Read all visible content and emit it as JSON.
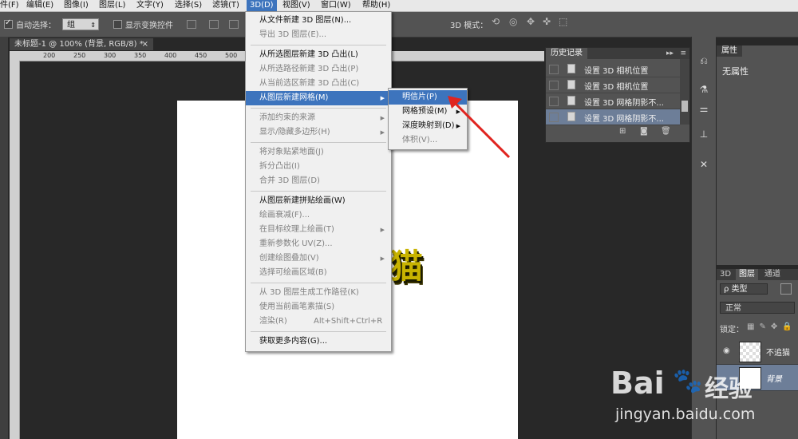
{
  "menubar": {
    "items": [
      "件(F)",
      "编辑(E)",
      "图像(I)",
      "图层(L)",
      "文字(Y)",
      "选择(S)",
      "滤镜(T)",
      "3D(D)",
      "视图(V)",
      "窗口(W)",
      "帮助(H)"
    ],
    "active": "3D(D)"
  },
  "options": {
    "auto_select_label": "自动选择：",
    "auto_select_value": "组",
    "show_transform_label": "显示变换控件",
    "mode_3d_label": "3D 模式："
  },
  "document": {
    "tab_title": "未标题-1 @ 100% (背景, RGB/8) *",
    "close_glyph": "×",
    "ruler_ticks": [
      "150",
      "200",
      "250",
      "300",
      "350",
      "400",
      "450",
      "500",
      "550",
      "600",
      "650",
      "700",
      "750",
      "800",
      "850",
      "900",
      "950",
      "1000",
      "1050",
      "1100"
    ],
    "canvas_text": "猫"
  },
  "menu_3d": {
    "items": [
      {
        "label": "从文件新建 3D 图层(N)...",
        "enabled": true
      },
      {
        "label": "导出 3D 图层(E)...",
        "enabled": false
      },
      {
        "sep": true
      },
      {
        "label": "从所选图层新建 3D 凸出(L)",
        "enabled": true
      },
      {
        "label": "从所选路径新建 3D 凸出(P)",
        "enabled": false
      },
      {
        "label": "从当前选区新建 3D 凸出(C)",
        "enabled": false
      },
      {
        "label": "从图层新建网格(M)",
        "enabled": true,
        "highlight": true,
        "submenu": true
      },
      {
        "sep": true
      },
      {
        "label": "添加约束的来源",
        "enabled": false,
        "submenu": true
      },
      {
        "label": "显示/隐藏多边形(H)",
        "enabled": false,
        "submenu": true
      },
      {
        "sep": true
      },
      {
        "label": "将对象贴紧地面(J)",
        "enabled": false
      },
      {
        "label": "拆分凸出(I)",
        "enabled": false
      },
      {
        "label": "合并 3D 图层(D)",
        "enabled": false
      },
      {
        "sep": true
      },
      {
        "label": "从图层新建拼贴绘画(W)",
        "enabled": true
      },
      {
        "label": "绘画衰减(F)...",
        "enabled": false
      },
      {
        "label": "在目标纹理上绘画(T)",
        "enabled": false,
        "submenu": true
      },
      {
        "label": "重新参数化 UV(Z)...",
        "enabled": false
      },
      {
        "label": "创建绘图叠加(V)",
        "enabled": false,
        "submenu": true
      },
      {
        "label": "选择可绘画区域(B)",
        "enabled": false
      },
      {
        "sep": true
      },
      {
        "label": "从 3D 图层生成工作路径(K)",
        "enabled": false
      },
      {
        "label": "使用当前画笔素描(S)",
        "enabled": false
      },
      {
        "label": "渲染(R)",
        "enabled": false,
        "shortcut": "Alt+Shift+Ctrl+R"
      },
      {
        "sep": true
      },
      {
        "label": "获取更多内容(G)...",
        "enabled": true
      }
    ]
  },
  "submenu_mesh": {
    "items": [
      {
        "label": "明信片(P)",
        "enabled": true,
        "highlight": true
      },
      {
        "label": "网格预设(M)",
        "enabled": true,
        "submenu": true
      },
      {
        "label": "深度映射到(D)",
        "enabled": true,
        "submenu": true
      },
      {
        "label": "体积(V)...",
        "enabled": false
      }
    ]
  },
  "history": {
    "title": "历史记录",
    "rows": [
      "设置 3D 相机位置",
      "设置 3D 相机位置",
      "设置 3D 网格阴影不...",
      "设置 3D 网格阴影不..."
    ]
  },
  "properties": {
    "tab": "属性",
    "text": "无属性"
  },
  "layers": {
    "tabs": [
      "3D",
      "图层",
      "通道"
    ],
    "kind_label": "ρ 类型",
    "blend_mode": "正常",
    "lock_label": "锁定：",
    "rows": [
      {
        "name": "不追猫",
        "selected": false
      },
      {
        "name": "背景",
        "selected": true
      }
    ]
  },
  "watermark": {
    "brand_top": "Bai",
    "brand_mid": "经验",
    "url": "jingyan.baidu.com"
  },
  "colors": {
    "highlight": "#3d74bd",
    "arrow": "#e0241f",
    "panel": "#535353"
  }
}
